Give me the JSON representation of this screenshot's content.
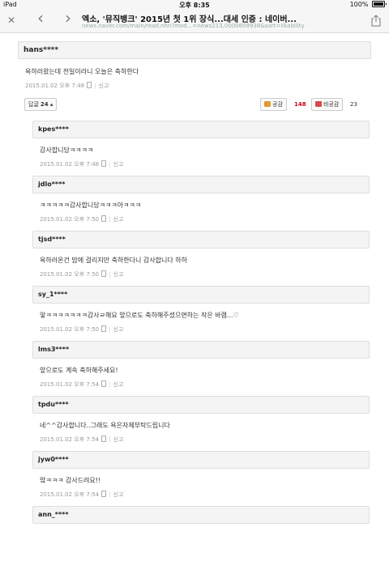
{
  "status_bar": {
    "device": "iPad",
    "time": "오후 8:35",
    "battery": "100%"
  },
  "nav": {
    "title": "엑소, '뮤직뱅크' 2015년 첫 1위 장식...대세 인증 : 네이버...",
    "url": "news.naver.com/main/read.nhn?mod...=news213,0000609938&sort=likability",
    "close_glyph": "✕",
    "back_glyph": "‹",
    "forward_glyph": "›"
  },
  "top_comment": {
    "user": "hans****",
    "text": "욕하러왔는데 천일이라니 오늘은 축하한다",
    "date": "2015.01.02 오후 7:48",
    "report": "신고",
    "reply_label": "답글",
    "reply_count": "24",
    "like_label": "공감",
    "like_count": "148",
    "dislike_label": "비공감",
    "dislike_count": "23"
  },
  "replies": [
    {
      "user": "kpes****",
      "text": "감사합니당ㅋㅋㅋㅋ",
      "date": "2015.01.02 오후 7:48",
      "report": "신고"
    },
    {
      "user": "jdlo****",
      "text": "ㅋㅋㅋㅋㅋ감사합니당ㅋㅋㅋ아ㅋㅋㅋ",
      "date": "2015.01.02 오후 7:50",
      "report": "신고"
    },
    {
      "user": "tjsd****",
      "text": "욕하러온건 맘에 걸리지만 축하한다니 감사합니다 하하",
      "date": "2015.01.02 오후 7:50",
      "report": "신고"
    },
    {
      "user": "sy_1****",
      "text": "앟ㅋㅋㅋㅋㅋㅋㅋ감사ㄹ해요 앞으로도 축하해주셨으면하는 작은 바램...♡",
      "date": "2015.01.02 오후 7:50",
      "report": "신고"
    },
    {
      "user": "lms3****",
      "text": "앞으로도 계속 축하해주세요!",
      "date": "2015.01.02 오후 7:54",
      "report": "신고"
    },
    {
      "user": "tpdu****",
      "text": "네^^감사합니다..그래도 욕은자제부탁드립니다",
      "date": "2015.01.02 오후 7:54",
      "report": "신고"
    },
    {
      "user": "jyw0****",
      "text": "앜ㅋㅋㅋ 감사드려요!!",
      "date": "2015.01.02 오후 7:54",
      "report": "신고"
    },
    {
      "user": "ann_****",
      "text": "",
      "date": "",
      "report": ""
    }
  ]
}
